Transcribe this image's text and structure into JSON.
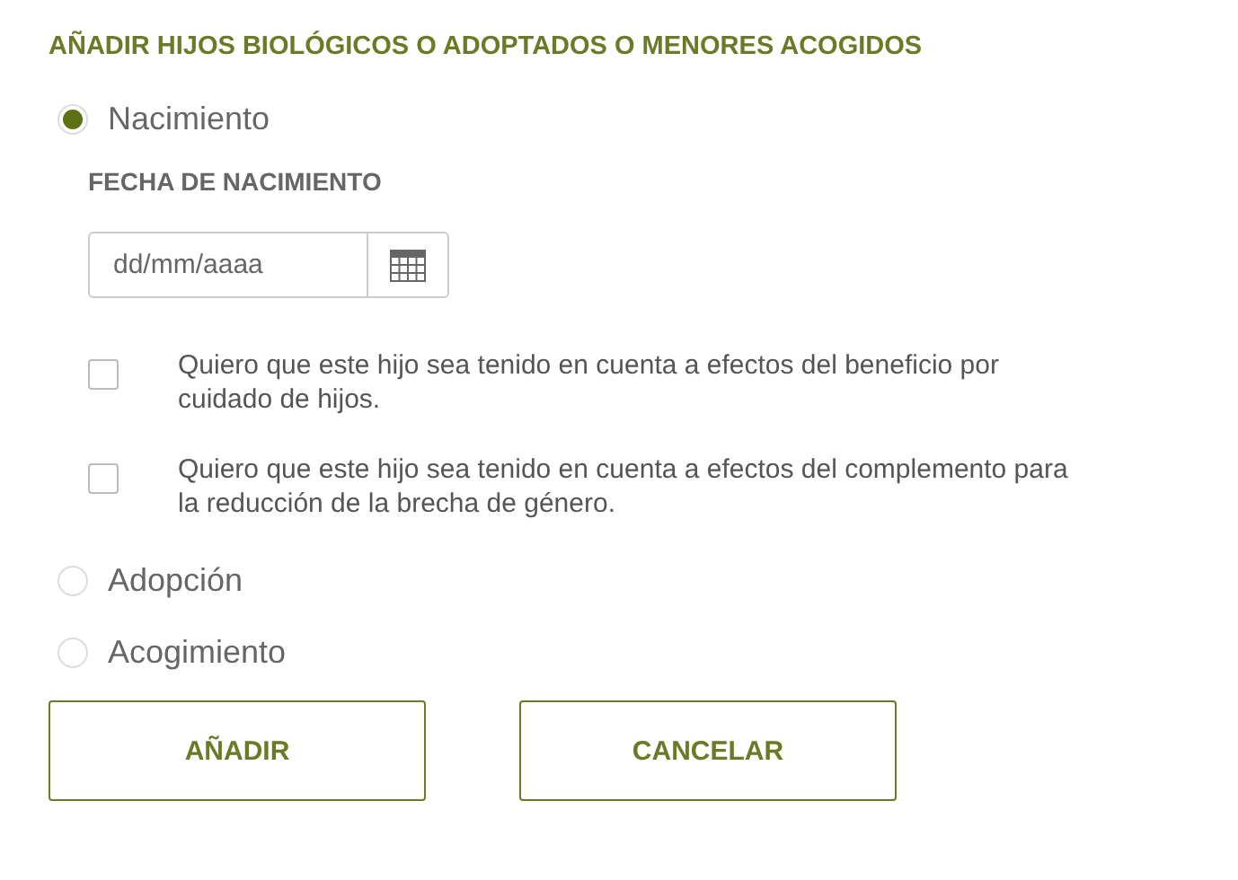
{
  "heading": "AÑADIR HIJOS BIOLÓGICOS O ADOPTADOS O MENORES ACOGIDOS",
  "options": [
    {
      "label": "Nacimiento",
      "selected": true,
      "date_field": {
        "label": "FECHA DE NACIMIENTO",
        "placeholder": "dd/mm/aaaa"
      },
      "checkboxes": [
        {
          "label": "Quiero que este hijo sea tenido en cuenta a efectos del beneficio por cuidado de hijos.",
          "checked": false
        },
        {
          "label": "Quiero que este hijo sea tenido en cuenta a efectos del complemento para la reducción de la brecha de género.",
          "checked": false
        }
      ]
    },
    {
      "label": "Adopción",
      "selected": false
    },
    {
      "label": "Acogimiento",
      "selected": false
    }
  ],
  "buttons": [
    "AÑADIR",
    "CANCELAR"
  ]
}
